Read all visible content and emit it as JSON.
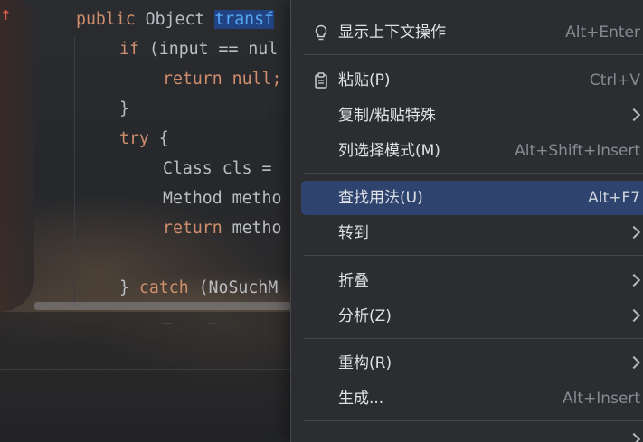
{
  "editor": {
    "code_lines": [
      {
        "kw": "public",
        "text": " Object ",
        "hl": "transf"
      },
      {
        "kw": "if",
        "text": " (input == nul"
      },
      {
        "kw": "return",
        "text": " null;"
      },
      {
        "text": "}"
      },
      {
        "kw": "try",
        "text": " {"
      },
      {
        "text": "Class cls = "
      },
      {
        "text": "Method metho"
      },
      {
        "kw": "return",
        "text": " metho"
      },
      {
        "pre": "} ",
        "kw": "catch",
        "text": " (NoSuchM"
      }
    ]
  },
  "context_menu": {
    "items": [
      {
        "label": "显示上下文操作",
        "shortcut": "Alt+Enter",
        "icon": "lightbulb-icon"
      },
      {
        "label": "粘贴(P)",
        "shortcut": "Ctrl+V",
        "icon": "clipboard-icon"
      },
      {
        "label": "复制/粘贴特殊",
        "submenu": true
      },
      {
        "label": "列选择模式(M)",
        "shortcut": "Alt+Shift+Insert"
      },
      {
        "label": "查找用法(U)",
        "shortcut": "Alt+F7",
        "selected": true
      },
      {
        "label": "转到",
        "submenu": true
      },
      {
        "label": "折叠",
        "submenu": true
      },
      {
        "label": "分析(Z)",
        "submenu": true
      },
      {
        "label": "重构(R)",
        "submenu": true
      },
      {
        "label": "生成...",
        "shortcut": "Alt+Insert"
      }
    ]
  },
  "colors": {
    "menu_bg": "#2b2d30",
    "selection": "#2e436e",
    "keyword": "#cf8e6d",
    "text": "#bcbec4"
  }
}
